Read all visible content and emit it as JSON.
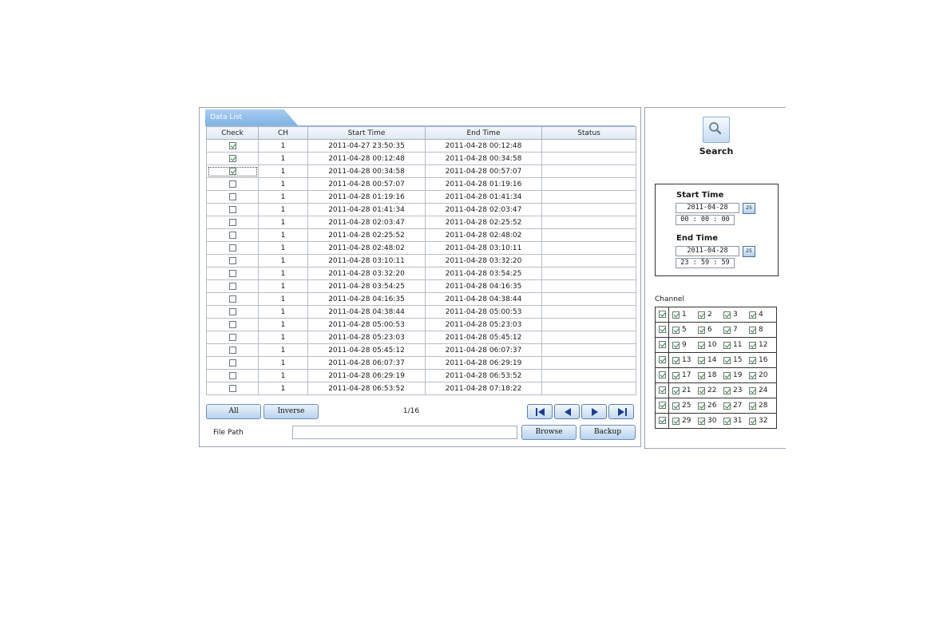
{
  "tab_label": "Data List",
  "columns": [
    "Check",
    "CH",
    "Start Time",
    "End Time",
    "Status"
  ],
  "rows": [
    {
      "checked": true,
      "ch": "1",
      "start": "2011-04-27 23:50:35",
      "end": "2011-04-28 00:12:48",
      "status": ""
    },
    {
      "checked": true,
      "ch": "1",
      "start": "2011-04-28 00:12:48",
      "end": "2011-04-28 00:34:58",
      "status": ""
    },
    {
      "checked": true,
      "ch": "1",
      "start": "2011-04-28 00:34:58",
      "end": "2011-04-28 00:57:07",
      "status": ""
    },
    {
      "checked": false,
      "ch": "1",
      "start": "2011-04-28 00:57:07",
      "end": "2011-04-28 01:19:16",
      "status": ""
    },
    {
      "checked": false,
      "ch": "1",
      "start": "2011-04-28 01:19:16",
      "end": "2011-04-28 01:41:34",
      "status": ""
    },
    {
      "checked": false,
      "ch": "1",
      "start": "2011-04-28 01:41:34",
      "end": "2011-04-28 02:03:47",
      "status": ""
    },
    {
      "checked": false,
      "ch": "1",
      "start": "2011-04-28 02:03:47",
      "end": "2011-04-28 02:25:52",
      "status": ""
    },
    {
      "checked": false,
      "ch": "1",
      "start": "2011-04-28 02:25:52",
      "end": "2011-04-28 02:48:02",
      "status": ""
    },
    {
      "checked": false,
      "ch": "1",
      "start": "2011-04-28 02:48:02",
      "end": "2011-04-28 03:10:11",
      "status": ""
    },
    {
      "checked": false,
      "ch": "1",
      "start": "2011-04-28 03:10:11",
      "end": "2011-04-28 03:32:20",
      "status": ""
    },
    {
      "checked": false,
      "ch": "1",
      "start": "2011-04-28 03:32:20",
      "end": "2011-04-28 03:54:25",
      "status": ""
    },
    {
      "checked": false,
      "ch": "1",
      "start": "2011-04-28 03:54:25",
      "end": "2011-04-28 04:16:35",
      "status": ""
    },
    {
      "checked": false,
      "ch": "1",
      "start": "2011-04-28 04:16:35",
      "end": "2011-04-28 04:38:44",
      "status": ""
    },
    {
      "checked": false,
      "ch": "1",
      "start": "2011-04-28 04:38:44",
      "end": "2011-04-28 05:00:53",
      "status": ""
    },
    {
      "checked": false,
      "ch": "1",
      "start": "2011-04-28 05:00:53",
      "end": "2011-04-28 05:23:03",
      "status": ""
    },
    {
      "checked": false,
      "ch": "1",
      "start": "2011-04-28 05:23:03",
      "end": "2011-04-28 05:45:12",
      "status": ""
    },
    {
      "checked": false,
      "ch": "1",
      "start": "2011-04-28 05:45:12",
      "end": "2011-04-28 06:07:37",
      "status": ""
    },
    {
      "checked": false,
      "ch": "1",
      "start": "2011-04-28 06:07:37",
      "end": "2011-04-28 06:29:19",
      "status": ""
    },
    {
      "checked": false,
      "ch": "1",
      "start": "2011-04-28 06:29:19",
      "end": "2011-04-28 06:53:52",
      "status": ""
    },
    {
      "checked": false,
      "ch": "1",
      "start": "2011-04-28 06:53:52",
      "end": "2011-04-28 07:18:22",
      "status": ""
    }
  ],
  "buttons": {
    "all": "All",
    "inverse": "Inverse",
    "browse": "Browse",
    "backup": "Backup"
  },
  "page_info": "1/16",
  "nav_icons": [
    "first-page-icon",
    "prev-page-icon",
    "next-page-icon",
    "last-page-icon"
  ],
  "file_path": {
    "label": "File Path",
    "value": ""
  },
  "search": {
    "label": "Search",
    "icon": "magnifier-icon"
  },
  "start_time": {
    "title": "Start Time",
    "date": "2011-04-28",
    "time": "00 : 00 : 00",
    "calendar_label": "25"
  },
  "end_time": {
    "title": "End Time",
    "date": "2011-04-28",
    "time": "23 : 59 : 59",
    "calendar_label": "25"
  },
  "channel": {
    "label": "Channel",
    "rows": [
      {
        "master": true,
        "items": [
          {
            "n": "1",
            "on": true
          },
          {
            "n": "2",
            "on": true
          },
          {
            "n": "3",
            "on": true
          },
          {
            "n": "4",
            "on": true
          }
        ]
      },
      {
        "master": true,
        "items": [
          {
            "n": "5",
            "on": true
          },
          {
            "n": "6",
            "on": true
          },
          {
            "n": "7",
            "on": true
          },
          {
            "n": "8",
            "on": true
          }
        ]
      },
      {
        "master": true,
        "items": [
          {
            "n": "9",
            "on": true
          },
          {
            "n": "10",
            "on": true
          },
          {
            "n": "11",
            "on": true
          },
          {
            "n": "12",
            "on": true
          }
        ]
      },
      {
        "master": true,
        "items": [
          {
            "n": "13",
            "on": true
          },
          {
            "n": "14",
            "on": true
          },
          {
            "n": "15",
            "on": true
          },
          {
            "n": "16",
            "on": true
          }
        ]
      },
      {
        "master": true,
        "items": [
          {
            "n": "17",
            "on": true
          },
          {
            "n": "18",
            "on": true
          },
          {
            "n": "19",
            "on": true
          },
          {
            "n": "20",
            "on": true
          }
        ]
      },
      {
        "master": true,
        "items": [
          {
            "n": "21",
            "on": true
          },
          {
            "n": "22",
            "on": true
          },
          {
            "n": "23",
            "on": true
          },
          {
            "n": "24",
            "on": true
          }
        ]
      },
      {
        "master": true,
        "items": [
          {
            "n": "25",
            "on": true
          },
          {
            "n": "26",
            "on": true
          },
          {
            "n": "27",
            "on": true
          },
          {
            "n": "28",
            "on": true
          }
        ]
      },
      {
        "master": true,
        "items": [
          {
            "n": "29",
            "on": true
          },
          {
            "n": "30",
            "on": true
          },
          {
            "n": "31",
            "on": true
          },
          {
            "n": "32",
            "on": true
          }
        ]
      }
    ]
  },
  "colors": {
    "tab": "#8fbfed",
    "button_border": "#6e8fb8",
    "check_mark": "#1e8a1e"
  }
}
